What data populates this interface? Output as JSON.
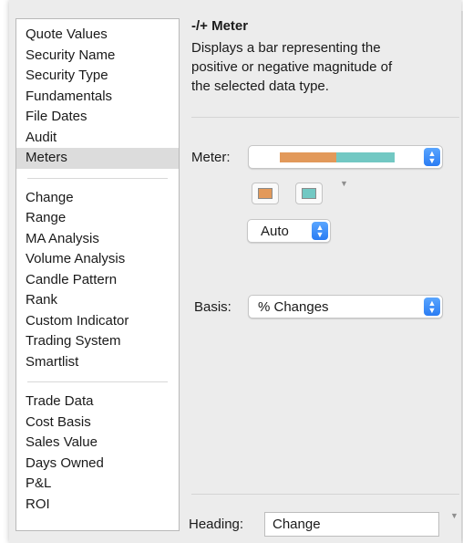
{
  "list": {
    "group1": [
      "Quote Values",
      "Security Name",
      "Security Type",
      "Fundamentals",
      "File Dates",
      "Audit",
      "Meters"
    ],
    "group2": [
      "Change",
      "Range",
      "MA Analysis",
      "Volume Analysis",
      "Candle Pattern",
      "Rank",
      "Custom Indicator",
      "Trading System",
      "Smartlist"
    ],
    "group3": [
      "Trade Data",
      "Cost Basis",
      "Sales Value",
      "Days Owned",
      "P&L",
      "ROI"
    ],
    "selected": "Meters"
  },
  "panel": {
    "title": "-/+ Meter",
    "desc_line1": "Displays a bar representing the",
    "desc_line2": "positive or negative magnitude of",
    "desc_line3": "the selected data type."
  },
  "meter": {
    "label": "Meter:",
    "negative_color": "#e2995a",
    "positive_color": "#72c8c3",
    "scale_value": "Auto"
  },
  "basis": {
    "label": "Basis:",
    "value": "% Changes"
  },
  "heading": {
    "label": "Heading:",
    "value": "Change"
  },
  "icons": {
    "stepper": "up-down-chevron-icon",
    "disclosure": "triangle-down-icon"
  }
}
